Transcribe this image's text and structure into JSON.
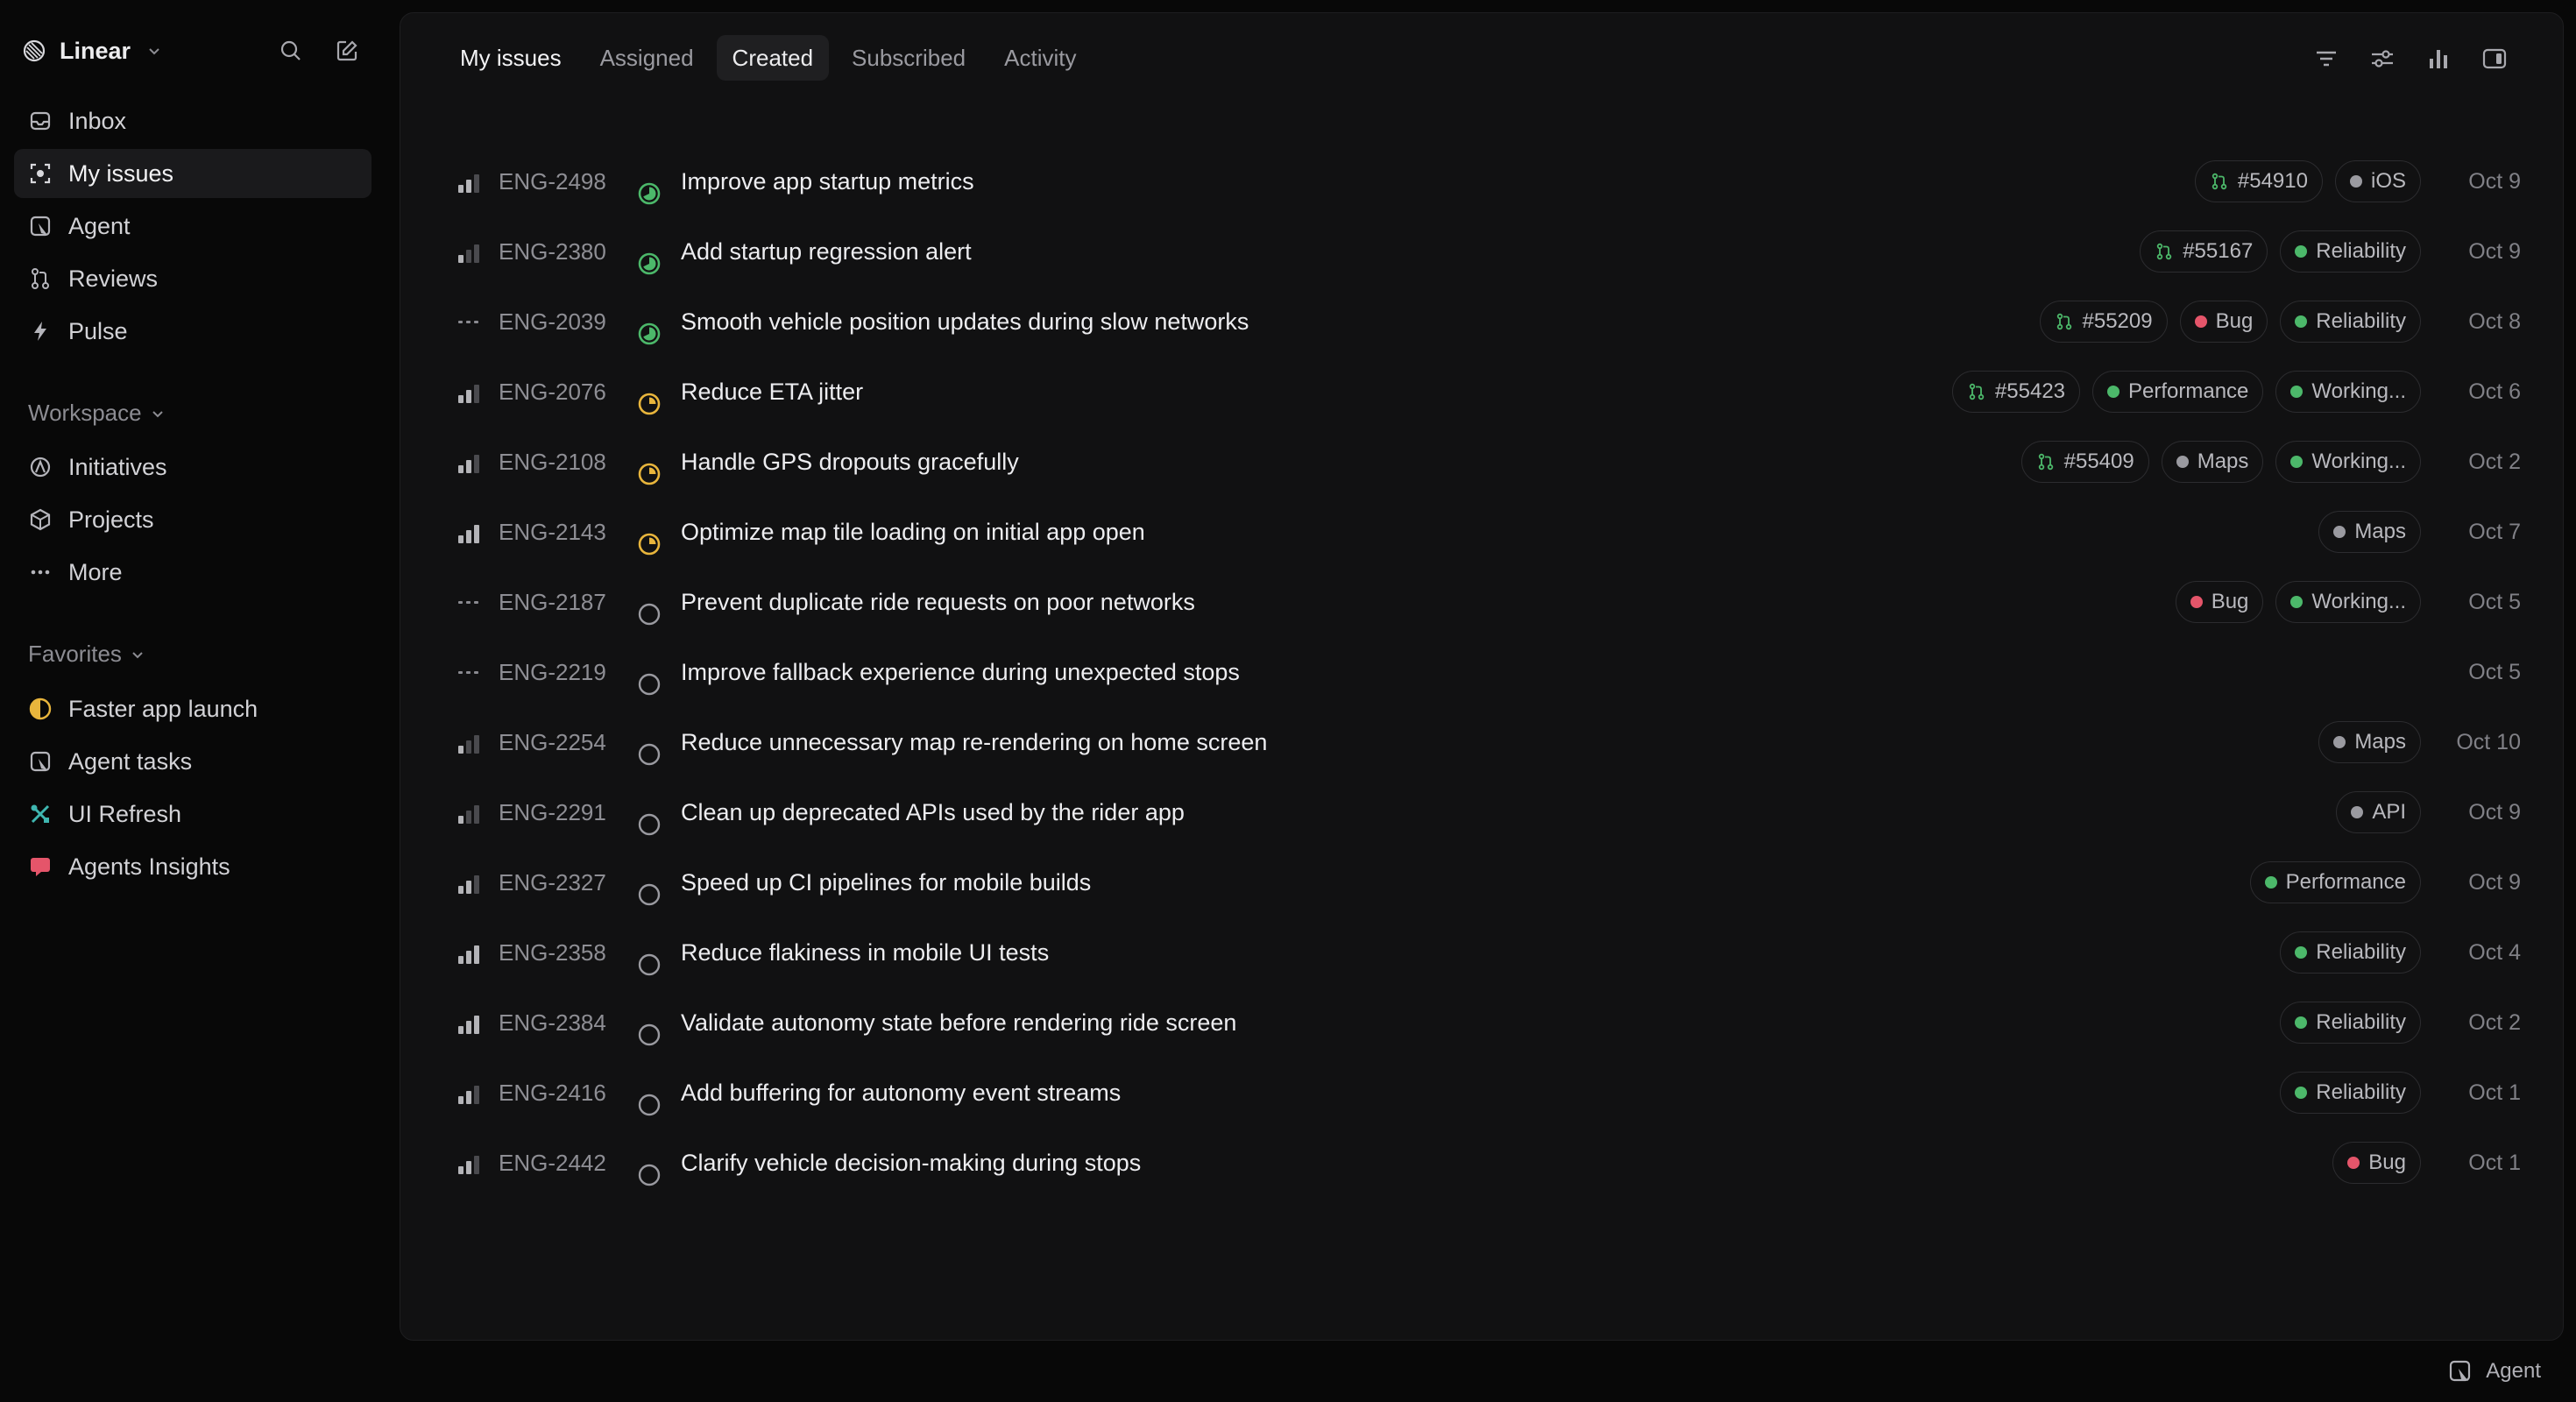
{
  "workspace": {
    "name": "Linear"
  },
  "sidebar": {
    "primary": [
      {
        "label": "Inbox",
        "icon": "inbox-icon",
        "active": false
      },
      {
        "label": "My issues",
        "icon": "my-issues-icon",
        "active": true
      },
      {
        "label": "Agent",
        "icon": "agent-icon",
        "active": false
      },
      {
        "label": "Reviews",
        "icon": "pull-request-icon",
        "active": false
      },
      {
        "label": "Pulse",
        "icon": "pulse-icon",
        "active": false
      }
    ],
    "workspace_label": "Workspace",
    "workspace_items": [
      {
        "label": "Initiatives",
        "icon": "initiatives-icon"
      },
      {
        "label": "Projects",
        "icon": "projects-icon"
      },
      {
        "label": "More",
        "icon": "more-icon"
      }
    ],
    "favorites_label": "Favorites",
    "favorites": [
      {
        "label": "Faster app launch",
        "icon": "half-circle-icon"
      },
      {
        "label": "Agent tasks",
        "icon": "agent-icon"
      },
      {
        "label": "UI Refresh",
        "icon": "tools-icon"
      },
      {
        "label": "Agents Insights",
        "icon": "insights-icon"
      }
    ]
  },
  "tabs": [
    {
      "label": "My issues",
      "selected": true
    },
    {
      "label": "Assigned"
    },
    {
      "label": "Created",
      "boxed": true
    },
    {
      "label": "Subscribed"
    },
    {
      "label": "Activity"
    }
  ],
  "issues": [
    {
      "id": "ENG-2498",
      "title": "Improve app startup metrics",
      "priority": 2,
      "status": "review",
      "pr": "#54910",
      "labels": [
        {
          "name": "iOS",
          "color": "#9a9aa0"
        }
      ],
      "date": "Oct 9"
    },
    {
      "id": "ENG-2380",
      "title": "Add startup regression alert",
      "priority": 1,
      "status": "review",
      "pr": "#55167",
      "labels": [
        {
          "name": "Reliability",
          "color": "#4cb86a"
        }
      ],
      "date": "Oct 9"
    },
    {
      "id": "ENG-2039",
      "title": "Smooth vehicle position updates during slow networks",
      "priority": 0,
      "status": "review",
      "pr": "#55209",
      "labels": [
        {
          "name": "Bug",
          "color": "#e5556a"
        },
        {
          "name": "Reliability",
          "color": "#4cb86a"
        }
      ],
      "date": "Oct 8"
    },
    {
      "id": "ENG-2076",
      "title": "Reduce ETA jitter",
      "priority": 2,
      "status": "in-progress",
      "pr": "#55423",
      "labels": [
        {
          "name": "Performance",
          "color": "#4cb86a"
        },
        {
          "name": "Working...",
          "color": "#4cb86a"
        }
      ],
      "date": "Oct 6"
    },
    {
      "id": "ENG-2108",
      "title": "Handle GPS dropouts gracefully",
      "priority": 2,
      "status": "in-progress",
      "pr": "#55409",
      "labels": [
        {
          "name": "Maps",
          "color": "#9a9aa0"
        },
        {
          "name": "Working...",
          "color": "#4cb86a"
        }
      ],
      "date": "Oct 2"
    },
    {
      "id": "ENG-2143",
      "title": "Optimize map tile loading on initial app open",
      "priority": 3,
      "status": "in-progress",
      "pr": "",
      "labels": [
        {
          "name": "Maps",
          "color": "#9a9aa0"
        }
      ],
      "date": "Oct 7"
    },
    {
      "id": "ENG-2187",
      "title": "Prevent duplicate ride requests on poor networks",
      "priority": 0,
      "status": "todo",
      "pr": "",
      "labels": [
        {
          "name": "Bug",
          "color": "#e5556a"
        },
        {
          "name": "Working...",
          "color": "#4cb86a"
        }
      ],
      "date": "Oct 5"
    },
    {
      "id": "ENG-2219",
      "title": "Improve fallback experience during unexpected stops",
      "priority": 0,
      "status": "todo",
      "pr": "",
      "labels": [],
      "date": "Oct 5"
    },
    {
      "id": "ENG-2254",
      "title": "Reduce unnecessary map re-rendering on home screen",
      "priority": 1,
      "status": "todo",
      "pr": "",
      "labels": [
        {
          "name": "Maps",
          "color": "#9a9aa0"
        }
      ],
      "date": "Oct 10"
    },
    {
      "id": "ENG-2291",
      "title": "Clean up deprecated APIs used by the rider app",
      "priority": 1,
      "status": "todo",
      "pr": "",
      "labels": [
        {
          "name": "API",
          "color": "#9a9aa0"
        }
      ],
      "date": "Oct 9"
    },
    {
      "id": "ENG-2327",
      "title": "Speed up CI pipelines for mobile builds",
      "priority": 2,
      "status": "todo",
      "pr": "",
      "labels": [
        {
          "name": "Performance",
          "color": "#4cb86a"
        }
      ],
      "date": "Oct 9"
    },
    {
      "id": "ENG-2358",
      "title": "Reduce flakiness in mobile UI tests",
      "priority": 3,
      "status": "todo",
      "pr": "",
      "labels": [
        {
          "name": "Reliability",
          "color": "#4cb86a"
        }
      ],
      "date": "Oct 4"
    },
    {
      "id": "ENG-2384",
      "title": "Validate autonomy state before rendering ride screen",
      "priority": 3,
      "status": "todo",
      "pr": "",
      "labels": [
        {
          "name": "Reliability",
          "color": "#4cb86a"
        }
      ],
      "date": "Oct 2"
    },
    {
      "id": "ENG-2416",
      "title": "Add buffering for autonomy event streams",
      "priority": 2,
      "status": "todo",
      "pr": "",
      "labels": [
        {
          "name": "Reliability",
          "color": "#4cb86a"
        }
      ],
      "date": "Oct 1"
    },
    {
      "id": "ENG-2442",
      "title": "Clarify vehicle decision-making during stops",
      "priority": 2,
      "status": "todo",
      "pr": "",
      "labels": [
        {
          "name": "Bug",
          "color": "#e5556a"
        }
      ],
      "date": "Oct 1"
    }
  ],
  "footer": {
    "agent_label": "Agent"
  },
  "colors": {
    "review": "#4cb86a",
    "in_progress": "#e8b53c",
    "todo": "#9a9aa0",
    "pr_icon": "#4cb86a"
  }
}
